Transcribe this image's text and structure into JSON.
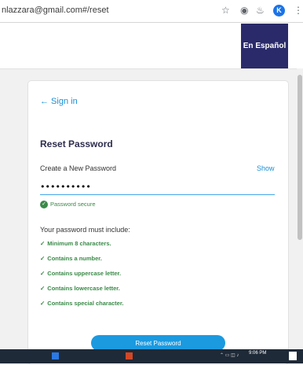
{
  "browser": {
    "url": "nlazzara@gmail.com#/reset",
    "avatar_initial": "K"
  },
  "header": {
    "language_button": "En Español"
  },
  "form": {
    "back_link": "← Sign in",
    "title": "Reset Password",
    "password_label": "Create a New Password",
    "show_label": "Show",
    "password_value": "••••••••••",
    "status": "Password secure",
    "requirements_heading": "Your password must include:",
    "requirements": [
      "Minimum 8 characters.",
      "Contains a number.",
      "Contains uppercase letter.",
      "Contains lowercase letter.",
      "Contains special character."
    ],
    "submit_label": "Reset Password"
  },
  "taskbar": {
    "clock": "9:06 PM"
  },
  "colors": {
    "accent": "#1b9ae0",
    "success": "#3a8a48",
    "header_button": "#2a2a6b"
  }
}
